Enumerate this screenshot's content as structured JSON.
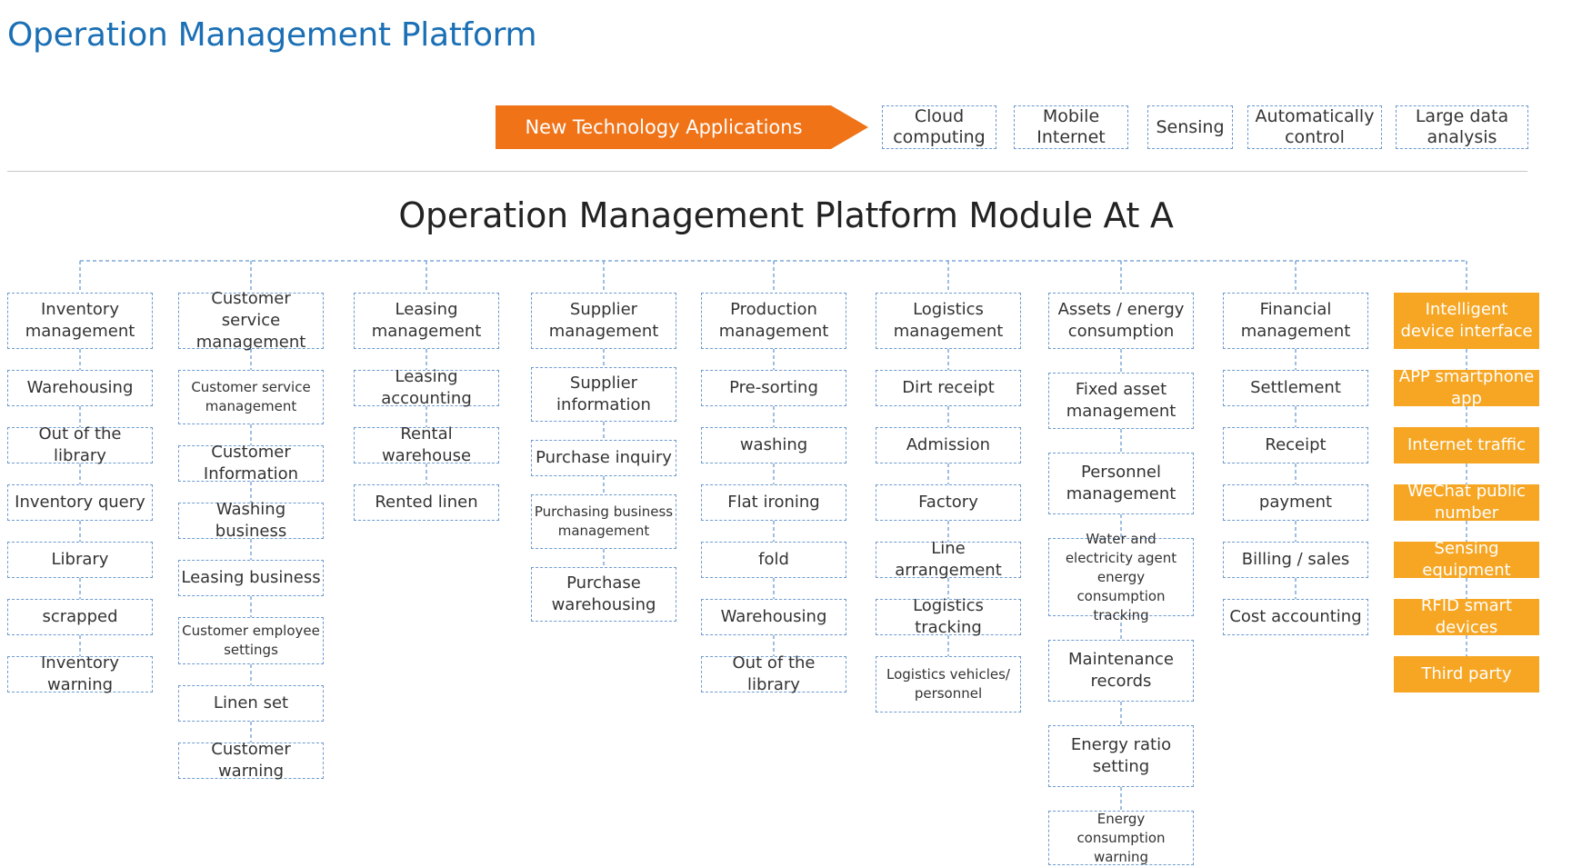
{
  "header": {
    "title": "Operation Management Platform"
  },
  "tech": {
    "label": "New Technology Applications",
    "items": [
      "Cloud computing",
      "Mobile Internet",
      "Sensing",
      "Automatically control",
      "Large data analysis"
    ]
  },
  "module": {
    "title": "Operation Management Platform Module At A"
  },
  "columns": [
    {
      "header": "Inventory management",
      "items": [
        "Warehousing",
        "Out of the library",
        "Inventory query",
        "Library",
        "scrapped",
        "Inventory warning"
      ]
    },
    {
      "header": "Customer service management",
      "items": [
        "Customer service management",
        "Customer Information",
        "Washing business",
        "Leasing business",
        "Customer employee settings",
        "Linen set",
        "Customer warning"
      ]
    },
    {
      "header": "Leasing management",
      "items": [
        "Leasing accounting",
        "Rental warehouse",
        "Rented linen"
      ]
    },
    {
      "header": "Supplier management",
      "items": [
        "Supplier information",
        "Purchase inquiry",
        "Purchasing business management",
        "Purchase warehousing"
      ]
    },
    {
      "header": "Production management",
      "items": [
        "Pre-sorting",
        "washing",
        "Flat ironing",
        "fold",
        "Warehousing",
        "Out of the library"
      ]
    },
    {
      "header": "Logistics management",
      "items": [
        "Dirt receipt",
        "Admission",
        "Factory",
        "Line arrangement",
        "Logistics tracking",
        "Logistics vehicles/ personnel"
      ]
    },
    {
      "header": "Assets / energy consumption",
      "items": [
        "Fixed asset management",
        "Personnel management",
        "Water and electricity agent energy consumption tracking",
        "Maintenance records",
        "Energy ratio setting",
        "Energy consumption warning"
      ]
    },
    {
      "header": "Financial management",
      "items": [
        "Settlement",
        "Receipt",
        "payment",
        "Billing / sales",
        "Cost accounting"
      ]
    },
    {
      "header": "Intelligent device interface",
      "items": [
        "APP smartphone app",
        "Internet traffic",
        "WeChat public number",
        "Sensing equipment",
        "RFID smart devices",
        "Third party"
      ]
    }
  ],
  "colors": {
    "title_blue": "#1a6fb5",
    "arrow_orange": "#f07318",
    "highlight_orange": "#f6a623",
    "dashed_border": "#6d9bd1"
  }
}
